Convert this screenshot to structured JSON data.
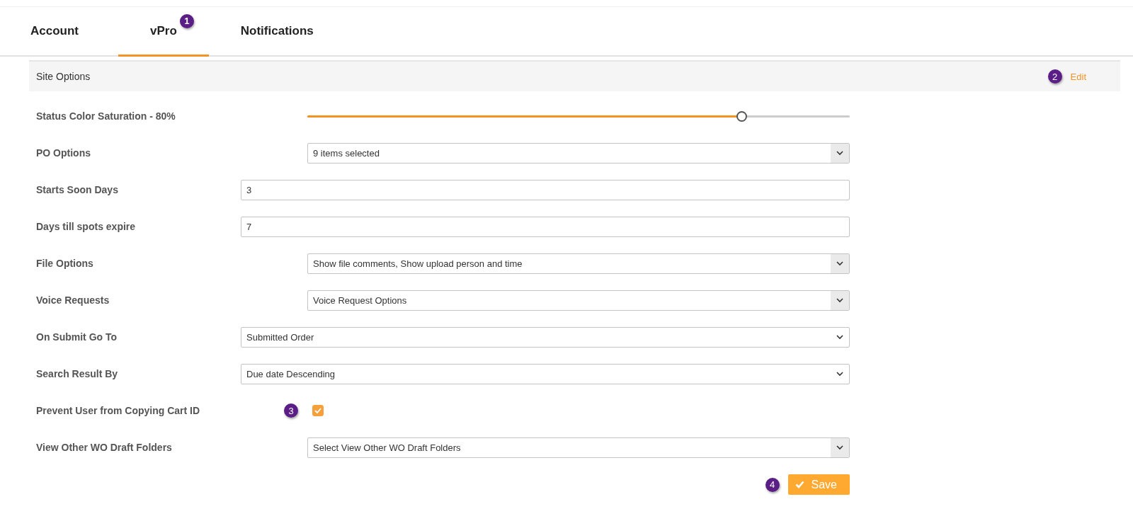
{
  "tabs": [
    {
      "label": "Account",
      "selected": false
    },
    {
      "label": "vPro",
      "selected": true,
      "badge": "1"
    },
    {
      "label": "Notifications",
      "selected": false
    }
  ],
  "section": {
    "title": "Site Options",
    "badge": "2",
    "action": "Edit"
  },
  "fields": [
    {
      "kind": "slider",
      "label": "Status Color Saturation - 80%",
      "level": 0.8
    },
    {
      "kind": "multiselect",
      "label": "PO Options",
      "value": "9 items selected"
    },
    {
      "kind": "text",
      "label": "Starts Soon Days",
      "value": "3"
    },
    {
      "kind": "text",
      "label": "Days till spots expire",
      "value": "7"
    },
    {
      "kind": "multiselect",
      "label": "File Options",
      "value": "Show file comments, Show upload person and time"
    },
    {
      "kind": "multiselect",
      "label": "Voice Requests",
      "value": "Voice Request Options"
    },
    {
      "kind": "select",
      "label": "On Submit Go To",
      "value": "Submitted Order"
    },
    {
      "kind": "select",
      "label": "Search Result By",
      "value": "Due date Descending"
    },
    {
      "kind": "checkbox",
      "label": "Prevent User from Copying Cart ID",
      "checked": true,
      "badge": "3"
    },
    {
      "kind": "multiselect",
      "label": "View Other WO Draft Folders",
      "value": "Select View Other WO Draft Folders"
    }
  ],
  "save": {
    "label": "Save",
    "badge": "4"
  }
}
